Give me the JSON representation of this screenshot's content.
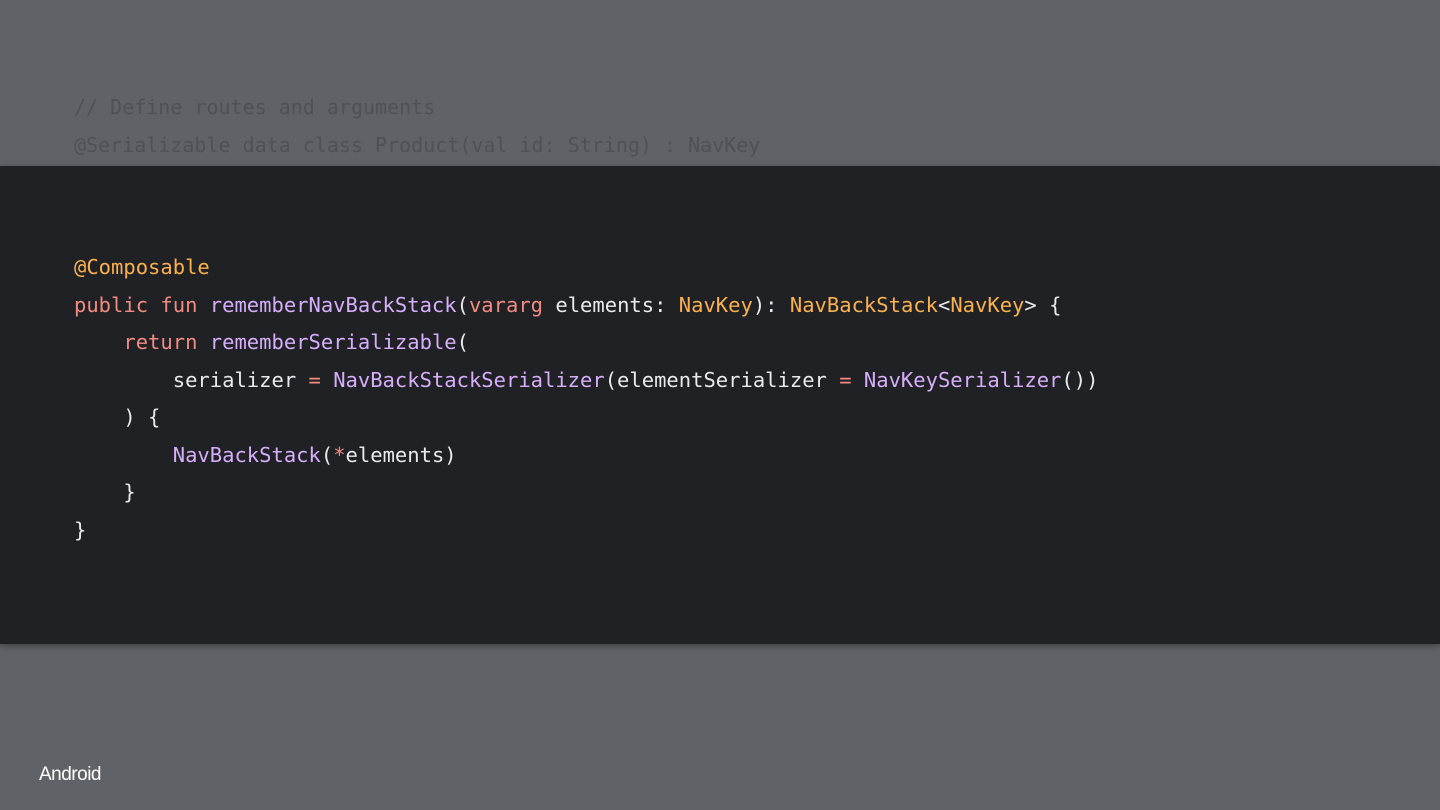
{
  "background_code": {
    "line1": "// Define routes and arguments",
    "line2": "@Serializable data class Product(val id: String) : NavKey"
  },
  "code_lines": [
    [
      {
        "t": "@Composable",
        "c": "anno"
      }
    ],
    [
      {
        "t": "public fun ",
        "c": "kw"
      },
      {
        "t": "rememberNavBackStack",
        "c": "fn"
      },
      {
        "t": "(",
        "c": "plain"
      },
      {
        "t": "vararg ",
        "c": "kw"
      },
      {
        "t": "elements: ",
        "c": "plain"
      },
      {
        "t": "NavKey",
        "c": "type"
      },
      {
        "t": "): ",
        "c": "plain"
      },
      {
        "t": "NavBackStack",
        "c": "type"
      },
      {
        "t": "<",
        "c": "plain"
      },
      {
        "t": "NavKey",
        "c": "type"
      },
      {
        "t": "> {",
        "c": "plain"
      }
    ],
    [
      {
        "t": "    ",
        "c": "plain"
      },
      {
        "t": "return ",
        "c": "kw"
      },
      {
        "t": "rememberSerializable",
        "c": "fn"
      },
      {
        "t": "(",
        "c": "plain"
      }
    ],
    [
      {
        "t": "        serializer ",
        "c": "plain"
      },
      {
        "t": "= ",
        "c": "kw"
      },
      {
        "t": "NavBackStackSerializer",
        "c": "fn"
      },
      {
        "t": "(elementSerializer ",
        "c": "plain"
      },
      {
        "t": "= ",
        "c": "kw"
      },
      {
        "t": "NavKeySerializer",
        "c": "fn"
      },
      {
        "t": "())",
        "c": "plain"
      }
    ],
    [
      {
        "t": "    ) {",
        "c": "plain"
      }
    ],
    [
      {
        "t": "        ",
        "c": "plain"
      },
      {
        "t": "NavBackStack",
        "c": "fn"
      },
      {
        "t": "(",
        "c": "plain"
      },
      {
        "t": "*",
        "c": "kw"
      },
      {
        "t": "elements)",
        "c": "plain"
      }
    ],
    [
      {
        "t": "    }",
        "c": "plain"
      }
    ],
    [
      {
        "t": "}",
        "c": "plain"
      }
    ]
  ],
  "brand": {
    "name": "Android"
  }
}
